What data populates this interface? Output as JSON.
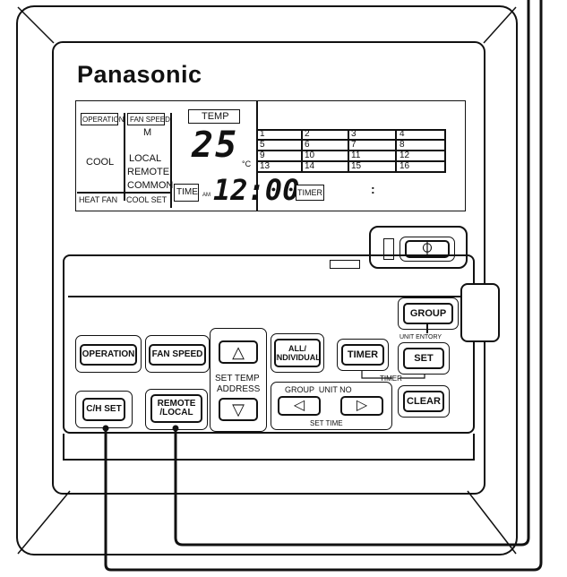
{
  "brand": "Panasonic",
  "display": {
    "operation_label": "OPERATION",
    "fan_speed_label": "FAN SPEED",
    "fan_speed_value": "M",
    "mode_value": "COOL",
    "local_label": "LOCAL",
    "remote_label": "REMOTE",
    "common_label": "COMMON",
    "heat_fan_label": "HEAT FAN",
    "cool_set_label": "COOL SET",
    "temp_label": "TEMP",
    "temp_value": "25",
    "temp_unit": "°C",
    "time_label": "TIME",
    "am_label": "AM",
    "time_value": "12:00",
    "timer_label": "TIMER",
    "timer_value": ":",
    "unit_grid": [
      [
        "1",
        "2",
        "3",
        "4"
      ],
      [
        "5",
        "6",
        "7",
        "8"
      ],
      [
        "9",
        "10",
        "11",
        "12"
      ],
      [
        "13",
        "14",
        "15",
        "16"
      ]
    ]
  },
  "buttons": {
    "operation": "OPERATION",
    "fan_speed": "FAN SPEED",
    "all_individual_1": "ALL/",
    "all_individual_2": "INDIVIDUAL",
    "timer": "TIMER",
    "group": "GROUP",
    "set": "SET",
    "clear": "CLEAR",
    "ch_set": "C/H SET",
    "remote_local_1": "REMOTE",
    "remote_local_2": "/LOCAL",
    "temp_up": "△",
    "temp_down": "▽",
    "group_left": "◁",
    "group_right": "▷",
    "power": "⏀"
  },
  "labels": {
    "unit_entory": "UNIT ENTORY",
    "timer_bracket": "TIMER",
    "set_temp": "SET TEMP",
    "address": "ADDRESS",
    "group_unit_no": "GROUP  UNIT NO",
    "set_time": "SET TIME"
  }
}
